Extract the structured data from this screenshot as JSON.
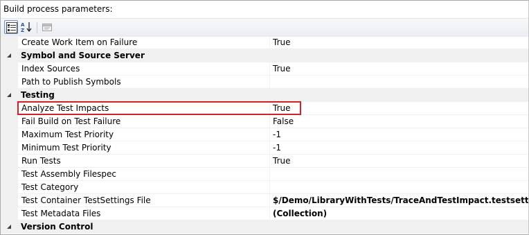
{
  "panel": {
    "title": "Build process parameters:"
  },
  "toolbar": {
    "categorized_icon": "categorized-view-icon",
    "alphabetical_icon": "alphabetical-sort-icon",
    "property_pages_icon": "property-pages-icon"
  },
  "rows": [
    {
      "kind": "prop",
      "name": "Create Work Item on Failure",
      "value": "True"
    },
    {
      "kind": "cat",
      "name": "Symbol and Source Server"
    },
    {
      "kind": "prop",
      "name": "Index Sources",
      "value": "True"
    },
    {
      "kind": "prop",
      "name": "Path to Publish Symbols",
      "value": ""
    },
    {
      "kind": "cat",
      "name": "Testing"
    },
    {
      "kind": "prop",
      "name": "Analyze Test Impacts",
      "value": "True"
    },
    {
      "kind": "prop",
      "name": "Fail Build on Test Failure",
      "value": "False"
    },
    {
      "kind": "prop",
      "name": "Maximum Test Priority",
      "value": "-1"
    },
    {
      "kind": "prop",
      "name": "Minimum Test Priority",
      "value": "-1"
    },
    {
      "kind": "prop",
      "name": "Run Tests",
      "value": "True"
    },
    {
      "kind": "prop",
      "name": "Test Assembly Filespec",
      "value": ""
    },
    {
      "kind": "prop",
      "name": "Test Category",
      "value": ""
    },
    {
      "kind": "prop",
      "name": "Test Container TestSettings File",
      "value": "$/Demo/LibraryWithTests/TraceAndTestImpact.testsettings",
      "bold": true
    },
    {
      "kind": "prop",
      "name": "Test Metadata Files",
      "value": "(Collection)",
      "bold": true
    },
    {
      "kind": "cat",
      "name": "Version Control"
    }
  ],
  "colors": {
    "highlight_border": "#d0202a",
    "gutter": "#f0f0f0",
    "grid_line": "#f0f0f0"
  }
}
